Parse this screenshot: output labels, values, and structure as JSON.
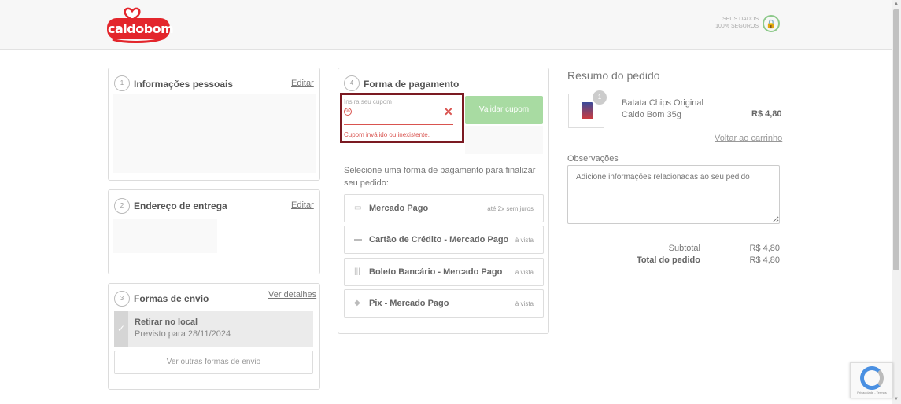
{
  "header": {
    "logo_text": "caldobom",
    "secure_text": "SEUS DADOS 100% SEGUROS",
    "secure_icon": "lock-icon"
  },
  "steps": {
    "personal": {
      "num": "1",
      "title": "Informações pessoais",
      "edit": "Editar"
    },
    "address": {
      "num": "2",
      "title": "Endereço de entrega",
      "edit": "Editar"
    },
    "shipping": {
      "num": "3",
      "title": "Formas de envio",
      "details": "Ver detalhes",
      "selected_title": "Retirar no local",
      "selected_date": "Previsto para 28/11/2024",
      "other": "Ver outras formas de envio"
    },
    "payment": {
      "num": "4",
      "title": "Forma de pagamento",
      "coupon_label": "Insira seu cupom",
      "coupon_value": "",
      "coupon_error": "Cupom inválido ou inexistente.",
      "validate": "Validar cupom",
      "instructions": "Selecione uma forma de pagamento para finalizar seu pedido:",
      "options": [
        {
          "name": "Mercado Pago",
          "note": "até 2x sem juros",
          "icon": "wallet-icon"
        },
        {
          "name": "Cartão de Crédito - Mercado Pago",
          "note": "à vista",
          "icon": "credit-card-icon"
        },
        {
          "name": "Boleto Bancário - Mercado Pago",
          "note": "à vista",
          "icon": "barcode-icon"
        },
        {
          "name": "Pix - Mercado Pago",
          "note": "à vista",
          "icon": "pix-icon"
        }
      ]
    }
  },
  "summary": {
    "title": "Resumo do pedido",
    "product": {
      "qty": "1",
      "name": "Batata Chips Original Caldo Bom 35g",
      "price": "R$ 4,80"
    },
    "back_link": "Voltar ao carrinho",
    "obs_label": "Observações",
    "obs_placeholder": "Adicione informações relacionadas ao seu pedido",
    "subtotal_label": "Subtotal",
    "subtotal_value": "R$ 4,80",
    "total_label": "Total do pedido",
    "total_value": "R$ 4,80"
  },
  "recaptcha": {
    "text": "Privacidade - Termos"
  },
  "colors": {
    "brand_red": "#e3262c",
    "error": "#d9534f",
    "accent_green": "#a8dba2",
    "highlight": "#7b1a22"
  }
}
